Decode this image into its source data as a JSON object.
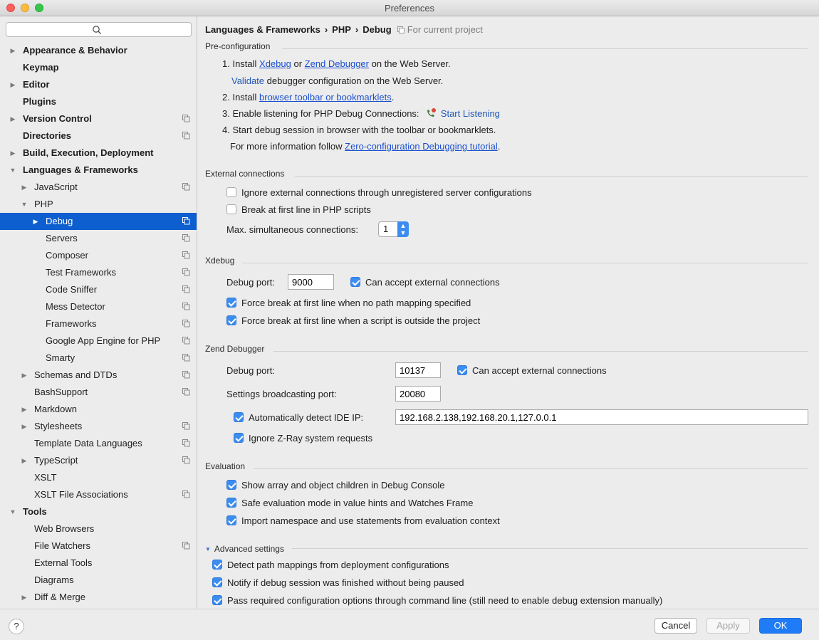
{
  "window": {
    "title": "Preferences"
  },
  "search": {
    "placeholder": ""
  },
  "sidebar": {
    "items": [
      {
        "label": "Appearance & Behavior",
        "bold": true,
        "level": 0,
        "arrow": "right",
        "proj": false
      },
      {
        "label": "Keymap",
        "bold": true,
        "level": 0,
        "arrow": "",
        "proj": false
      },
      {
        "label": "Editor",
        "bold": true,
        "level": 0,
        "arrow": "right",
        "proj": false
      },
      {
        "label": "Plugins",
        "bold": true,
        "level": 0,
        "arrow": "",
        "proj": false
      },
      {
        "label": "Version Control",
        "bold": true,
        "level": 0,
        "arrow": "right",
        "proj": true
      },
      {
        "label": "Directories",
        "bold": true,
        "level": 0,
        "arrow": "",
        "proj": true
      },
      {
        "label": "Build, Execution, Deployment",
        "bold": true,
        "level": 0,
        "arrow": "right",
        "proj": false
      },
      {
        "label": "Languages & Frameworks",
        "bold": true,
        "level": 0,
        "arrow": "down",
        "proj": false
      },
      {
        "label": "JavaScript",
        "bold": false,
        "level": 1,
        "arrow": "right",
        "proj": true
      },
      {
        "label": "PHP",
        "bold": false,
        "level": 1,
        "arrow": "down",
        "proj": false
      },
      {
        "label": "Debug",
        "bold": false,
        "level": 2,
        "arrow": "right",
        "proj": true,
        "selected": true
      },
      {
        "label": "Servers",
        "bold": false,
        "level": 2,
        "arrow": "",
        "proj": true
      },
      {
        "label": "Composer",
        "bold": false,
        "level": 2,
        "arrow": "",
        "proj": true
      },
      {
        "label": "Test Frameworks",
        "bold": false,
        "level": 2,
        "arrow": "",
        "proj": true
      },
      {
        "label": "Code Sniffer",
        "bold": false,
        "level": 2,
        "arrow": "",
        "proj": true
      },
      {
        "label": "Mess Detector",
        "bold": false,
        "level": 2,
        "arrow": "",
        "proj": true
      },
      {
        "label": "Frameworks",
        "bold": false,
        "level": 2,
        "arrow": "",
        "proj": true
      },
      {
        "label": "Google App Engine for PHP",
        "bold": false,
        "level": 2,
        "arrow": "",
        "proj": true
      },
      {
        "label": "Smarty",
        "bold": false,
        "level": 2,
        "arrow": "",
        "proj": true
      },
      {
        "label": "Schemas and DTDs",
        "bold": false,
        "level": 1,
        "arrow": "right",
        "proj": true
      },
      {
        "label": "BashSupport",
        "bold": false,
        "level": 1,
        "arrow": "",
        "proj": true
      },
      {
        "label": "Markdown",
        "bold": false,
        "level": 1,
        "arrow": "right",
        "proj": false
      },
      {
        "label": "Stylesheets",
        "bold": false,
        "level": 1,
        "arrow": "right",
        "proj": true
      },
      {
        "label": "Template Data Languages",
        "bold": false,
        "level": 1,
        "arrow": "",
        "proj": true
      },
      {
        "label": "TypeScript",
        "bold": false,
        "level": 1,
        "arrow": "right",
        "proj": true
      },
      {
        "label": "XSLT",
        "bold": false,
        "level": 1,
        "arrow": "",
        "proj": false
      },
      {
        "label": "XSLT File Associations",
        "bold": false,
        "level": 1,
        "arrow": "",
        "proj": true
      },
      {
        "label": "Tools",
        "bold": true,
        "level": 0,
        "arrow": "down",
        "proj": false
      },
      {
        "label": "Web Browsers",
        "bold": false,
        "level": 1,
        "arrow": "",
        "proj": false
      },
      {
        "label": "File Watchers",
        "bold": false,
        "level": 1,
        "arrow": "",
        "proj": true
      },
      {
        "label": "External Tools",
        "bold": false,
        "level": 1,
        "arrow": "",
        "proj": false
      },
      {
        "label": "Diagrams",
        "bold": false,
        "level": 1,
        "arrow": "",
        "proj": false
      },
      {
        "label": "Diff & Merge",
        "bold": false,
        "level": 1,
        "arrow": "right",
        "proj": false
      }
    ]
  },
  "breadcrumb": {
    "part1": "Languages & Frameworks",
    "part2": "PHP",
    "part3": "Debug",
    "sep": "›",
    "scope": "For current project"
  },
  "preconfig": {
    "title": "Pre-configuration",
    "s1_prefix": "1. Install ",
    "s1_link1": "Xdebug",
    "s1_or": " or ",
    "s1_link2": "Zend Debugger",
    "s1_suffix": " on the Web Server.",
    "s1b_link": "Validate",
    "s1b_suffix": " debugger configuration on the Web Server.",
    "s2_prefix": "2. Install ",
    "s2_link": "browser toolbar or bookmarklets",
    "s2_suffix": ".",
    "s3_text": "3. Enable listening for PHP Debug Connections:",
    "s3_link": "Start Listening",
    "s4_text": "4. Start debug session in browser with the toolbar or bookmarklets.",
    "info_prefix": "For more information follow ",
    "info_link": "Zero-configuration Debugging tutorial",
    "info_suffix": "."
  },
  "external": {
    "title": "External connections",
    "ignore_label": "Ignore external connections through unregistered server configurations",
    "break_label": "Break at first line in PHP scripts",
    "max_label": "Max. simultaneous connections:",
    "max_value": "1",
    "spin_up": "▲",
    "spin_down": "▼"
  },
  "xdebug": {
    "title": "Xdebug",
    "port_label": "Debug port:",
    "port_value": "9000",
    "accept_label": "Can accept external connections",
    "force1_label": "Force break at first line when no path mapping specified",
    "force2_label": "Force break at first line when a script is outside the project"
  },
  "zend": {
    "title": "Zend Debugger",
    "port_label": "Debug port:",
    "port_value": "10137",
    "accept_label": "Can accept external connections",
    "broadcast_label": "Settings broadcasting port:",
    "broadcast_value": "20080",
    "detect_label": "Automatically detect IDE IP:",
    "detect_value": "192.168.2.138,192.168.20.1,127.0.0.1",
    "zray_label": "Ignore Z-Ray system requests"
  },
  "evaluation": {
    "title": "Evaluation",
    "opt1": "Show array and object children in Debug Console",
    "opt2": "Safe evaluation mode in value hints and Watches Frame",
    "opt3": "Import namespace and use statements from evaluation context"
  },
  "advanced": {
    "title": "Advanced settings",
    "opt1": "Detect path mappings from deployment configurations",
    "opt2": "Notify if debug session was finished without being paused",
    "opt3": "Pass required configuration options through command line (still need to enable debug extension manually)"
  },
  "footer": {
    "help": "?",
    "cancel": "Cancel",
    "apply": "Apply",
    "ok": "OK"
  }
}
